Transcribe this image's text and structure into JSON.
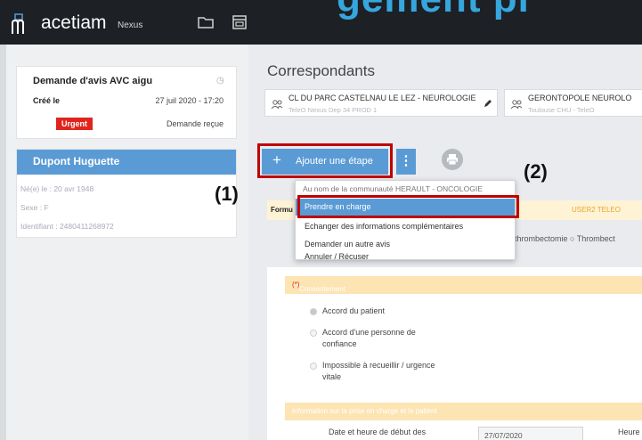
{
  "app": {
    "brand": "acetiam",
    "brand_sub": "Nexus",
    "banner_fragment": "gement pr"
  },
  "request": {
    "title": "Demande d'avis AVC aigu",
    "created_label": "Créé le",
    "created_value": "27 juil 2020 - 17:20",
    "urgency": "Urgent",
    "status": "Demande reçue"
  },
  "patient": {
    "name": "Dupont Huguette",
    "birth": "Né(e) le : 20 avr 1948",
    "sex": "Sexe : F",
    "id": "Identifiant : 2480411268972"
  },
  "main": {
    "title": "Correspondants",
    "correspondents": [
      {
        "name": "CL DU PARC CASTELNAU LE LEZ - NEUROLOGIE",
        "sub": "TeleO Nexus Dep 34 PROD 1"
      },
      {
        "name": "GERONTOPOLE NEUROLO",
        "sub": "Toulouse CHU - TeleO"
      }
    ],
    "add_step": "Ajouter une étape",
    "add_step_plus": "+",
    "kebab": "⋮"
  },
  "annotations": {
    "one": "(1)",
    "two": "(2)"
  },
  "dropdown": {
    "group": "Au nom de la communauté HERAULT - ONCOLOGIE",
    "items": [
      "Prendre en charge",
      "Echanger des informations complémentaires",
      "Demander un autre avis",
      "Annuler / Récuser"
    ]
  },
  "form": {
    "strip_label": "Formu",
    "strip_user": "USER2 TELEO",
    "thromb": "thrombectomie ○ Thrombect",
    "consent_label": "Consentement",
    "consent_req": "(*)",
    "options": [
      "Accord du patient",
      "Accord d'une personne de confiance",
      "Impossible à recueillir / urgence vitale"
    ],
    "info_label": "Information sur la prise en charge et le patient",
    "date_label": "Date et heure de début des",
    "date_value": "27/07/2020",
    "heure_label": "Heure"
  },
  "colors": {
    "accent": "#5b9bd5",
    "urgent": "#e0241c",
    "highlight_box": "#c00000",
    "banner": "#36a6dd"
  }
}
